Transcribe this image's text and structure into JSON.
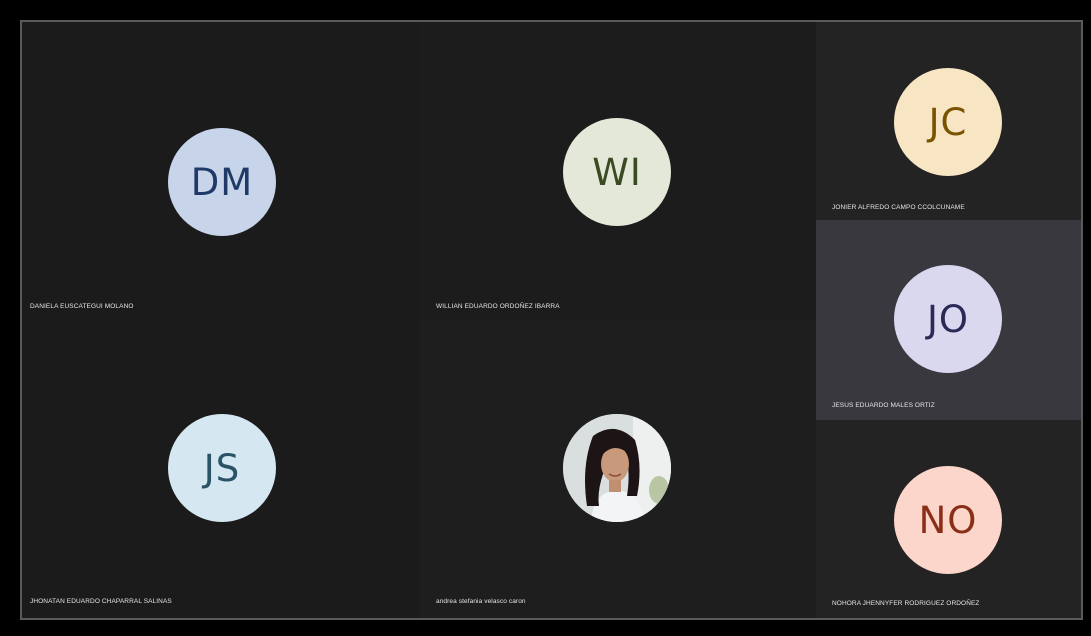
{
  "participants": [
    {
      "initials": "DM",
      "name": "DANIELA EUSCATEGUI MOLANO",
      "tile_bg": "#1b1b1b",
      "avatar_bg": "#c7d4ea",
      "avatar_fg": "#1f3a66"
    },
    {
      "initials": "WI",
      "name": "WILLIAN EDUARDO ORDOÑEZ IBARRA",
      "tile_bg": "#1c1c1c",
      "avatar_bg": "#e4e8d8",
      "avatar_fg": "#3a4a23"
    },
    {
      "initials": "JC",
      "name": "JONIER ALFREDO CAMPO CCOLCUNAME",
      "tile_bg": "#232323",
      "avatar_bg": "#f7e5c3",
      "avatar_fg": "#7a5300"
    },
    {
      "initials": "JO",
      "name": "JESUS EDUARDO MALES ORTIZ",
      "tile_bg": "#39383f",
      "avatar_bg": "#d9d8ef",
      "avatar_fg": "#2b2a57"
    },
    {
      "initials": "JS",
      "name": "JHONATAN EDUARDO CHAPARRAL SALINAS",
      "tile_bg": "#1b1b1b",
      "avatar_bg": "#d5e8f1",
      "avatar_fg": "#2a5366"
    },
    {
      "initials": "",
      "name": "andrea stefania velasco caron",
      "tile_bg": "#1e1e1e",
      "avatar_bg": "#cfd6d8",
      "avatar_fg": "#333333"
    },
    {
      "initials": "NO",
      "name": "NOHORA JHENNYFER RODRIGUEZ ORDOÑEZ",
      "tile_bg": "#232323",
      "avatar_bg": "#fcd5cb",
      "avatar_fg": "#8a2f17"
    }
  ]
}
